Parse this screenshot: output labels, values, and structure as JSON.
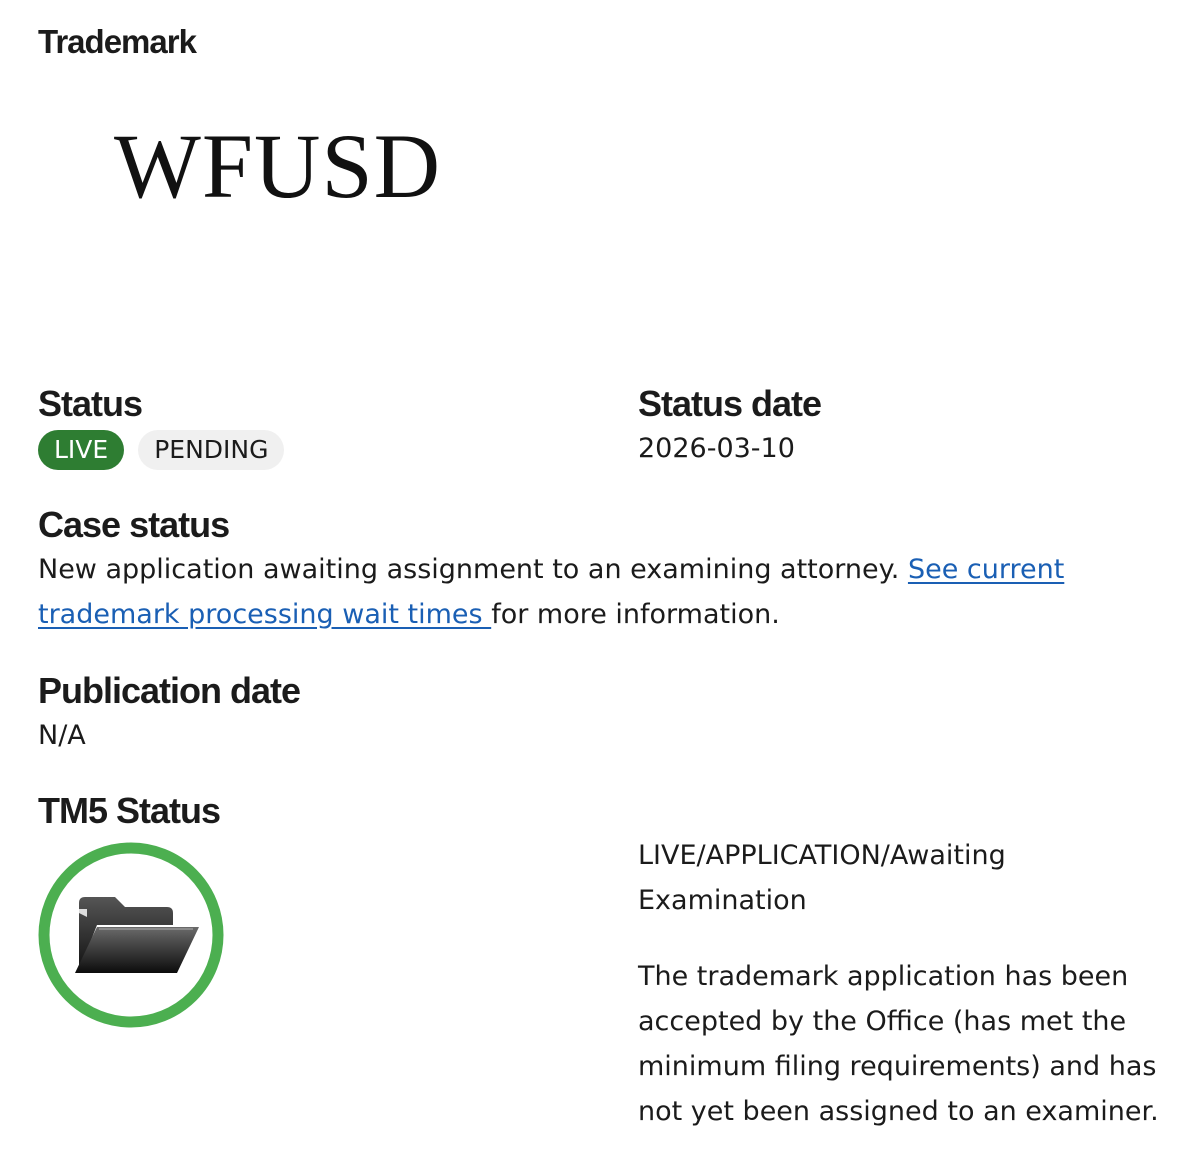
{
  "trademark": {
    "heading": "Trademark",
    "mark_text": "WFUSD"
  },
  "status": {
    "heading": "Status",
    "badges": [
      "LIVE",
      "PENDING"
    ],
    "colors": {
      "live_bg": "#2e7d32",
      "pending_bg": "#f0f0f0"
    }
  },
  "status_date": {
    "heading": "Status date",
    "value": "2026-03-10"
  },
  "case_status": {
    "heading": "Case status",
    "text_before": "New application awaiting assignment to an examining attorney. ",
    "link_text": "See current trademark processing wait times ",
    "text_after": "for more information."
  },
  "publication_date": {
    "heading": "Publication date",
    "value": "N/A"
  },
  "tm5_status": {
    "heading": "TM5 Status",
    "icon": "open-folder-icon",
    "colors": {
      "ring": "#4caf50"
    },
    "code": "LIVE/APPLICATION/Awaiting Examination",
    "description": "The trademark application has been accepted by the Office (has met the minimum filing requirements) and has not yet been assigned to an examiner."
  }
}
